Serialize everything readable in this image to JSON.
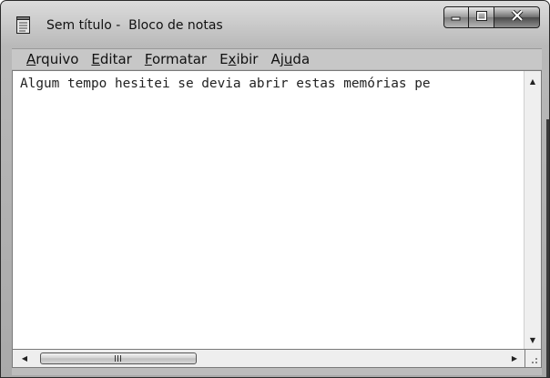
{
  "window": {
    "title": "Sem título -  Bloco de notas"
  },
  "menu": {
    "items": [
      {
        "label_pre": "",
        "label_key": "A",
        "label_post": "rquivo"
      },
      {
        "label_pre": "",
        "label_key": "E",
        "label_post": "ditar"
      },
      {
        "label_pre": "",
        "label_key": "F",
        "label_post": "ormatar"
      },
      {
        "label_pre": "E",
        "label_key": "x",
        "label_post": "ibir"
      },
      {
        "label_pre": "Aj",
        "label_key": "u",
        "label_post": "da"
      }
    ]
  },
  "editor": {
    "text": "Algum tempo hesitei se devia abrir estas memórias pe"
  },
  "icons": {
    "app": "notepad-icon",
    "minimize": "minimize-icon",
    "maximize": "maximize-icon",
    "close": "close-icon",
    "scroll_up": "up-arrow-icon",
    "scroll_down": "down-arrow-icon",
    "scroll_left": "left-arrow-icon",
    "scroll_right": "right-arrow-icon",
    "resize": "size-grip-icon"
  }
}
